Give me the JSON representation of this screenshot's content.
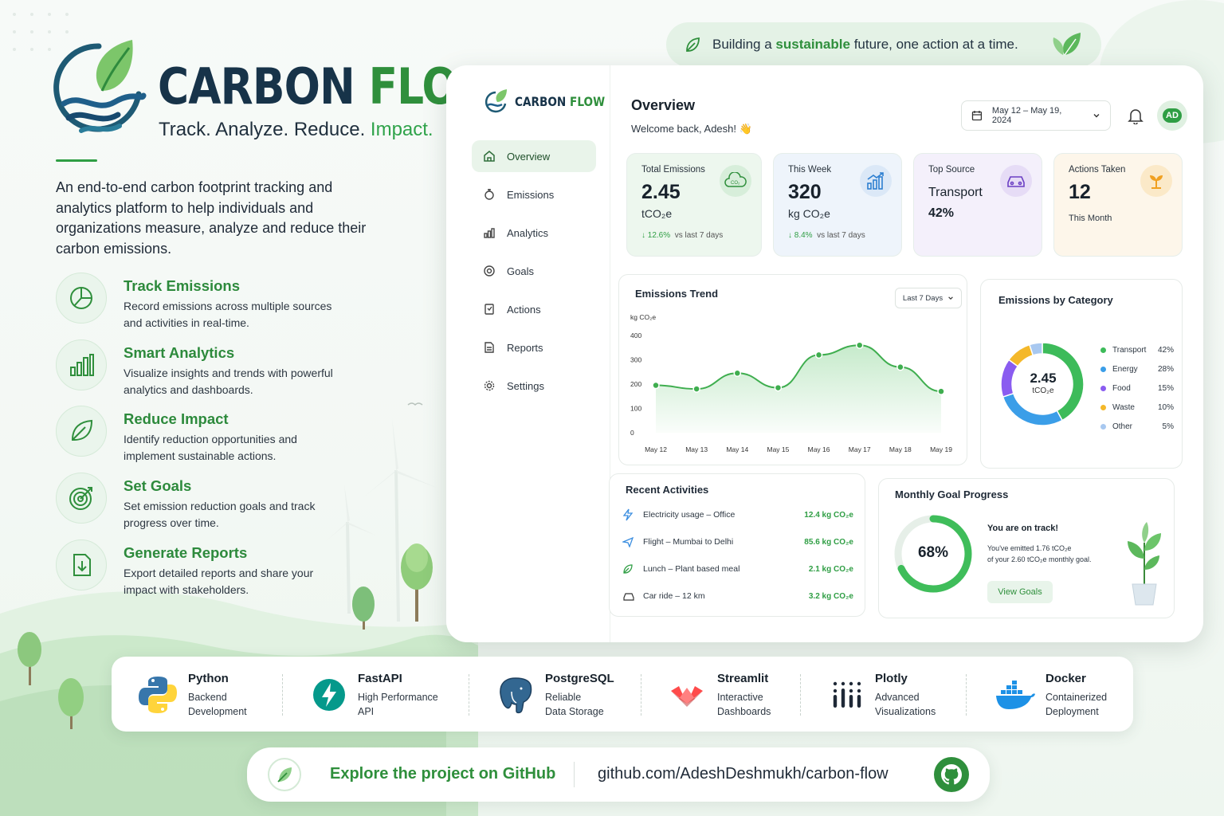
{
  "brand": {
    "name_part1": "CARBON",
    "name_part2": "FLOW",
    "tagline_part1": "Track. Analyze. Reduce.",
    "tagline_part2": "Impact.",
    "description": "An end-to-end carbon footprint tracking and analytics platform to help individuals and organizations measure, analyze and reduce their carbon emissions."
  },
  "features": [
    {
      "title": "Track Emissions",
      "desc": "Record emissions across multiple sources and activities in real-time.",
      "icon": "pie-chart-icon"
    },
    {
      "title": "Smart Analytics",
      "desc": "Visualize insights and trends with powerful analytics and dashboards.",
      "icon": "bar-chart-icon"
    },
    {
      "title": "Reduce Impact",
      "desc": "Identify reduction opportunities and implement sustainable actions.",
      "icon": "leaf-icon"
    },
    {
      "title": "Set Goals",
      "desc": "Set emission reduction goals and track progress over time.",
      "icon": "target-icon"
    },
    {
      "title": "Generate Reports",
      "desc": "Export detailed reports and share your impact with stakeholders.",
      "icon": "download-icon"
    }
  ],
  "slogan": {
    "before": "Building a",
    "highlight": "sustainable",
    "after": "future, one action at a time."
  },
  "dashboard": {
    "logo_text_1": "CARBON",
    "logo_text_2": "FLOW",
    "nav": [
      "Overview",
      "Emissions",
      "Analytics",
      "Goals",
      "Actions",
      "Reports",
      "Settings"
    ],
    "title": "Overview",
    "welcome": "Welcome back, Adesh! 👋",
    "date_range": "May 12 – May 19, 2024",
    "avatar": "AD",
    "kpis": [
      {
        "label": "Total Emissions",
        "value": "2.45",
        "unit": "tCO₂e",
        "delta": "↓ 12.6%",
        "delta_note": "vs last 7 days",
        "bg": "#edf7ee"
      },
      {
        "label": "This Week",
        "value": "320",
        "unit": "kg CO₂e",
        "delta": "↓ 8.4%",
        "delta_note": "vs last 7 days",
        "bg": "#eef4fb"
      },
      {
        "label": "Top Source",
        "value": "Transport",
        "unit": "42%",
        "bg": "#f4f0fb"
      },
      {
        "label": "Actions Taken",
        "value": "12",
        "unit": "This Month",
        "bg": "#fdf6ea"
      }
    ],
    "trend": {
      "title": "Emissions Trend",
      "filter": "Last 7 Days",
      "unit_label": "kg CO₂e"
    },
    "category": {
      "title": "Emissions by Category",
      "total": "2.45",
      "unit": "tCO₂e"
    },
    "activities": {
      "title": "Recent Activities",
      "items": [
        {
          "label": "Electricity usage – Office",
          "value": "12.4 kg CO₂e",
          "icon": "bolt-icon"
        },
        {
          "label": "Flight – Mumbai to Delhi",
          "value": "85.6 kg CO₂e",
          "icon": "plane-icon"
        },
        {
          "label": "Lunch – Plant based meal",
          "value": "2.1 kg CO₂e",
          "icon": "leaf-icon"
        },
        {
          "label": "Car ride – 12 km",
          "value": "3.2 kg CO₂e",
          "icon": "car-icon"
        }
      ]
    },
    "goal": {
      "title": "Monthly Goal Progress",
      "percent_label": "68%",
      "progress": 0.68,
      "status": "You are on track!",
      "line1": "You've emitted 1.76 tCO₂e",
      "line2": "of your 2.60 tCO₂e monthly goal.",
      "button": "View Goals"
    }
  },
  "chart_data": [
    {
      "type": "area",
      "title": "Emissions Trend",
      "ylabel": "kg CO₂e",
      "x": [
        "May 12",
        "May 13",
        "May 14",
        "May 15",
        "May 16",
        "May 17",
        "May 18",
        "May 19"
      ],
      "values": [
        195,
        180,
        245,
        185,
        320,
        360,
        270,
        170
      ],
      "ylim": [
        0,
        400
      ],
      "yticks": [
        0,
        100,
        200,
        300,
        400
      ],
      "grid": false
    },
    {
      "type": "pie",
      "title": "Emissions by Category",
      "categories": [
        "Transport",
        "Energy",
        "Food",
        "Waste",
        "Other"
      ],
      "values": [
        42,
        28,
        15,
        10,
        5
      ],
      "labels": [
        "42%",
        "28%",
        "15%",
        "10%",
        "5%"
      ],
      "colors": [
        "#3dbb5a",
        "#3b9ee8",
        "#8a5cf0",
        "#f4b82a",
        "#a8c8f0"
      ],
      "legend": "right"
    }
  ],
  "tech": [
    {
      "name": "Python",
      "line1": "Backend",
      "line2": "Development",
      "icon": "python-icon"
    },
    {
      "name": "FastAPI",
      "line1": "High Performance",
      "line2": "API",
      "icon": "fastapi-icon"
    },
    {
      "name": "PostgreSQL",
      "line1": "Reliable",
      "line2": "Data Storage",
      "icon": "postgresql-icon"
    },
    {
      "name": "Streamlit",
      "line1": "Interactive",
      "line2": "Dashboards",
      "icon": "streamlit-icon"
    },
    {
      "name": "Plotly",
      "line1": "Advanced",
      "line2": "Visualizations",
      "icon": "plotly-icon"
    },
    {
      "name": "Docker",
      "line1": "Containerized",
      "line2": "Deployment",
      "icon": "docker-icon"
    }
  ],
  "github": {
    "cta": "Explore the project on GitHub",
    "url": "github.com/AdeshDeshmukh/carbon-flow",
    "icon": "github-icon"
  },
  "colors": {
    "brand_green": "#2f8f3c",
    "brand_navy": "#173349",
    "accent_green": "#3dbb5a"
  }
}
